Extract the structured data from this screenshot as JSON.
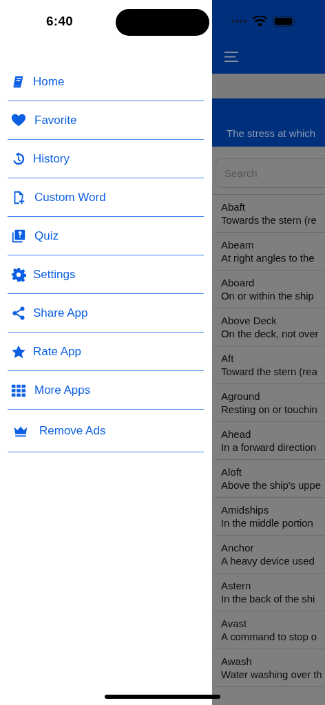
{
  "status_bar": {
    "time": "6:40"
  },
  "drawer": {
    "items": [
      {
        "label": "Home"
      },
      {
        "label": "Favorite"
      },
      {
        "label": "History"
      },
      {
        "label": "Custom Word"
      },
      {
        "label": "Quiz"
      },
      {
        "label": "Settings"
      },
      {
        "label": "Share App"
      },
      {
        "label": "Rate App"
      },
      {
        "label": "More Apps"
      },
      {
        "label": "Remove Ads"
      }
    ]
  },
  "main": {
    "banner": "The stress at which",
    "search": {
      "placeholder": "Search"
    },
    "terms": [
      {
        "word": "Abaft",
        "definition": "Towards the stern (re"
      },
      {
        "word": "Abeam",
        "definition": "At right angles to the"
      },
      {
        "word": "Aboard",
        "definition": "On or within the ship"
      },
      {
        "word": "Above Deck",
        "definition": "On the deck, not over"
      },
      {
        "word": "Aft",
        "definition": "Toward the stern (rea"
      },
      {
        "word": "Aground",
        "definition": "Resting on or touchin"
      },
      {
        "word": "Ahead",
        "definition": "In a forward direction"
      },
      {
        "word": "Aloft",
        "definition": "Above the ship's uppe"
      },
      {
        "word": "Amidships",
        "definition": "In the middle portion"
      },
      {
        "word": "Anchor",
        "definition": "A heavy device used"
      },
      {
        "word": "Astern",
        "definition": "In the back of the shi"
      },
      {
        "word": "Avast",
        "definition": "A command to stop o"
      },
      {
        "word": "Awash",
        "definition": "Water washing over th"
      }
    ]
  }
}
